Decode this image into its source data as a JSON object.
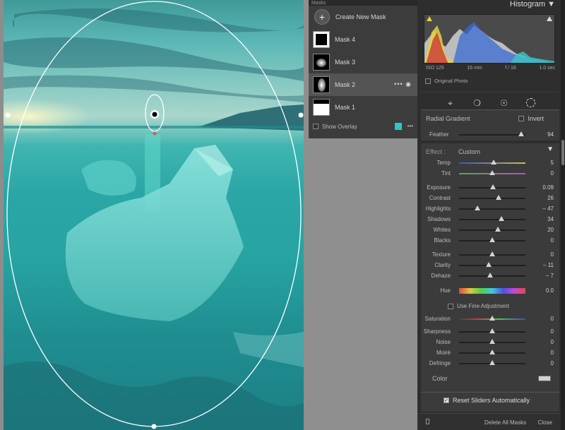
{
  "masks_panel": {
    "header": "Masks",
    "create_label": "Create New Mask",
    "items": [
      {
        "label": "Mask 4"
      },
      {
        "label": "Mask 3"
      },
      {
        "label": "Mask 2",
        "selected": true
      },
      {
        "label": "Mask 1"
      }
    ],
    "row_more": "•••",
    "show_overlay_label": "Show Overlay",
    "overlay_color": "#2cc9c4",
    "overlay_more": "•••"
  },
  "histogram": {
    "title": "Histogram",
    "iso": "ISO 125",
    "focal": "16 mm",
    "aperture": "f / 16",
    "shutter": "1.0 sec",
    "original_photo_label": "Original Photo"
  },
  "mask_settings": {
    "type_label": "Radial Gradient",
    "invert_label": "Invert",
    "feather_label": "Feather",
    "feather_value": "94",
    "feather_level": 0.94
  },
  "effect": {
    "effect_label": "Effect :",
    "preset_label": "Custom",
    "sliders_a": [
      {
        "label": "Temp",
        "value": "5",
        "pos": 0.52
      },
      {
        "label": "Tint",
        "value": "0",
        "pos": 0.5
      }
    ],
    "sliders_b": [
      {
        "label": "Exposure",
        "value": "0.09",
        "pos": 0.51
      },
      {
        "label": "Contrast",
        "value": "26",
        "pos": 0.6
      },
      {
        "label": "Highlights",
        "value": "– 47",
        "pos": 0.28
      },
      {
        "label": "Shadows",
        "value": "34",
        "pos": 0.64
      },
      {
        "label": "Whites",
        "value": "20",
        "pos": 0.58
      },
      {
        "label": "Blacks",
        "value": "0",
        "pos": 0.5
      }
    ],
    "sliders_c": [
      {
        "label": "Texture",
        "value": "0",
        "pos": 0.5
      },
      {
        "label": "Clarity",
        "value": "– 11",
        "pos": 0.45
      },
      {
        "label": "Dehaze",
        "value": "– 7",
        "pos": 0.47
      }
    ],
    "hue_label": "Hue",
    "hue_value": "0.0",
    "fine_adjust_label": "Use Fine Adjustment",
    "saturation_label": "Saturation",
    "saturation_value": "0",
    "sliders_d": [
      {
        "label": "Sharpness",
        "value": "0",
        "pos": 0.5
      },
      {
        "label": "Noise",
        "value": "0",
        "pos": 0.5
      },
      {
        "label": "Moiré",
        "value": "0",
        "pos": 0.5
      },
      {
        "label": "Defringe",
        "value": "0",
        "pos": 0.5
      }
    ],
    "color_label": "Color",
    "color_swatch": "#d8cfc8",
    "reset_label": "Reset Sliders Automatically"
  },
  "footer": {
    "delete_label": "Delete All Masks",
    "close_label": "Close"
  }
}
